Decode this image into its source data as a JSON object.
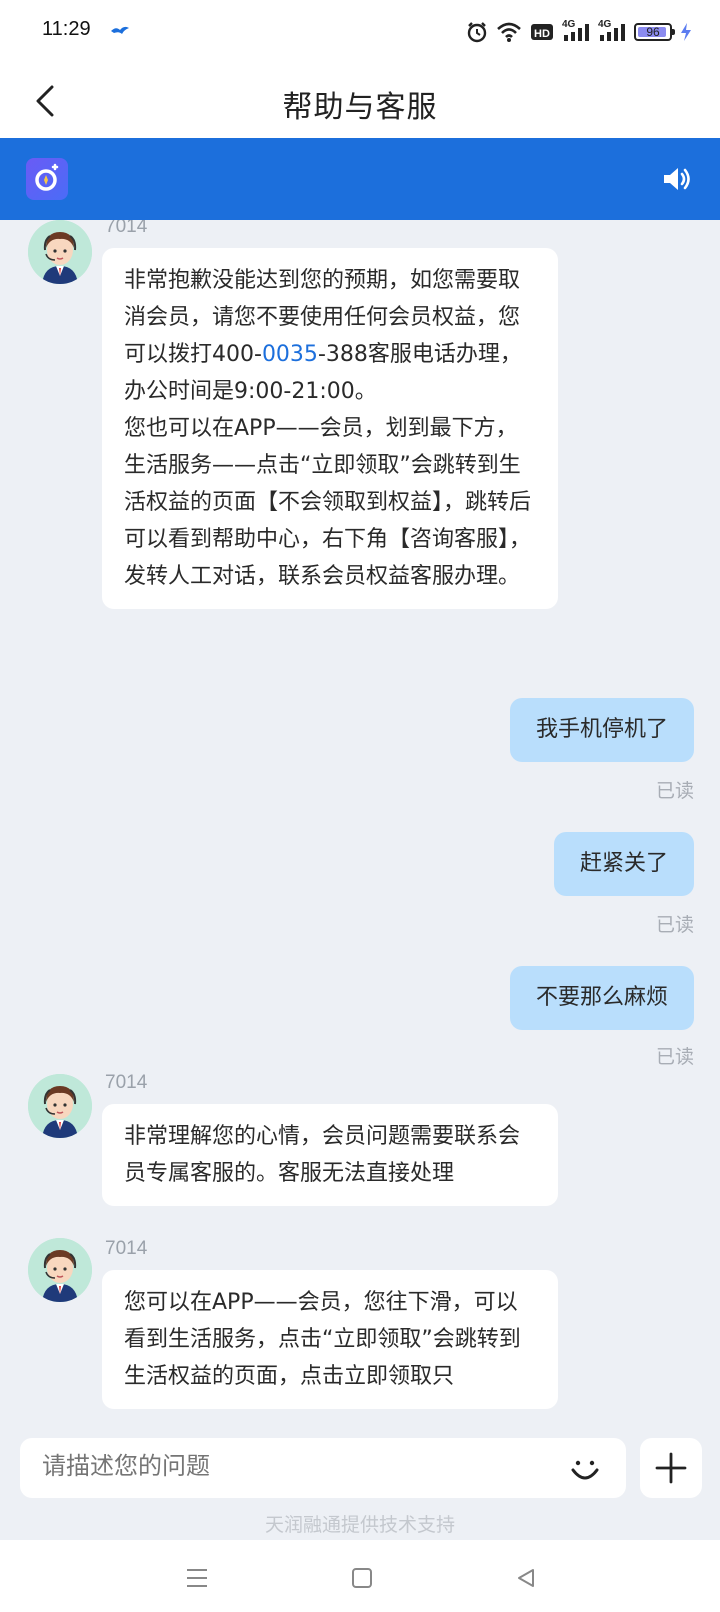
{
  "status_bar": {
    "time": "11:29",
    "network_left": "4G",
    "network_right": "4G",
    "battery": "96"
  },
  "header": {
    "title": "帮助与客服"
  },
  "messages": [
    {
      "sender": "7014",
      "text_before_link": "非常抱歉没能达到您的预期，如您需要取消会员，请您不要使用任何会员权益，您可以拨打400-",
      "link": "0035",
      "text_after_link": "-388客服电话办理，办公时间是9:00-21:00。",
      "text2": "您也可以在APP——会员，划到最下方，生活服务——点击“立即领取”会跳转到生活权益的页面【不会领取到权益】，跳转后可以看到帮助中心，右下角【咨询客服】，发转人工对话，联系会员权益客服办理。"
    },
    {
      "text": "我手机停机了",
      "read": "已读"
    },
    {
      "text": "赶紧关了",
      "read": "已读"
    },
    {
      "text": "不要那么麻烦",
      "read": "已读"
    },
    {
      "sender": "7014",
      "text": "非常理解您的心情，会员问题需要联系会员专属客服的。客服无法直接处理"
    },
    {
      "sender": "7014",
      "text": "您可以在APP——会员，您往下滑，可以看到生活服务，点击“立即领取”会跳转到生活权益的页面，点击立即领取只"
    }
  ],
  "input": {
    "placeholder": "请描述您的问题"
  },
  "footer": {
    "powered_by": "天润融通提供技术支持"
  },
  "colors": {
    "accent": "#1c6fdc",
    "bubble_out": "#b9defc",
    "background": "#edf0f5"
  }
}
